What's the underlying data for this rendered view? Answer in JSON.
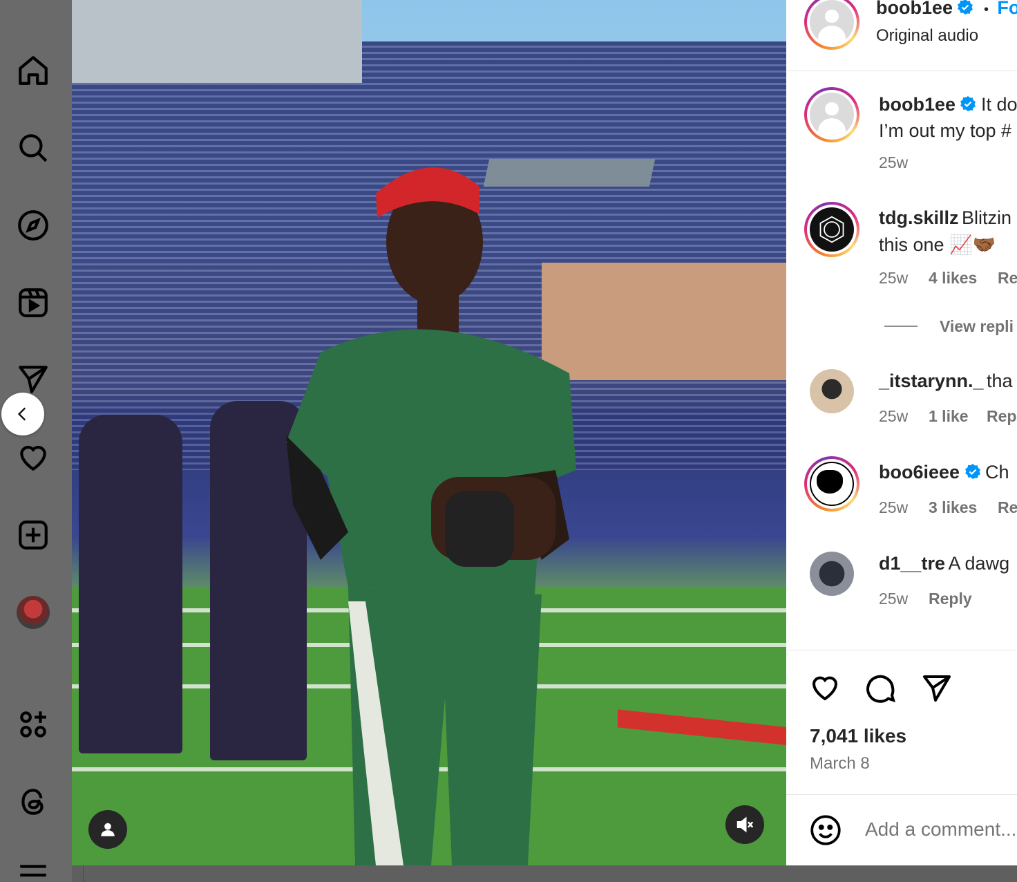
{
  "post": {
    "author": "boob1ee",
    "follow_label": "Fo",
    "dot": "•",
    "audio": "Original audio",
    "caption_text_1": "It do",
    "caption_text_2": "I’m out my top #",
    "caption_time": "25w",
    "likes": "7,041 likes",
    "date": "March 8"
  },
  "comments": [
    {
      "user": "tdg.skillz",
      "text": "Blitzin",
      "text2": "this one 📈🤝🏾",
      "time": "25w",
      "likes": "4 likes",
      "reply": "Re",
      "view_replies": "View repli"
    },
    {
      "user": "_itstarynn._",
      "text": "tha",
      "time": "25w",
      "likes": "1 like",
      "reply": "Rep"
    },
    {
      "user": "boo6ieee",
      "text": "Ch",
      "time": "25w",
      "likes": "3 likes",
      "reply": "Re"
    },
    {
      "user": "d1__tre",
      "text": "A dawg",
      "time": "25w",
      "reply": "Reply"
    }
  ],
  "comment_box": {
    "placeholder": "Add a comment..."
  },
  "colors": {
    "verified": "#0095f6",
    "link": "#0095f6",
    "muted": "#737373"
  }
}
